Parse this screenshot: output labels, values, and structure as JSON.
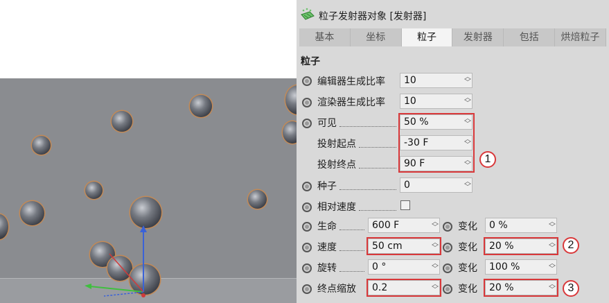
{
  "window": {
    "title": "粒子发射器对象 [发射器]"
  },
  "tabs": [
    {
      "label": "基本",
      "active": false
    },
    {
      "label": "坐标",
      "active": false
    },
    {
      "label": "粒子",
      "active": true
    },
    {
      "label": "发射器",
      "active": false
    },
    {
      "label": "包括",
      "active": false
    },
    {
      "label": "烘焙粒子",
      "active": false
    }
  ],
  "section_title": "粒子",
  "params": {
    "editor_rate": {
      "label": "编辑器生成比率",
      "value": "10"
    },
    "render_rate": {
      "label": "渲染器生成比率",
      "value": "10"
    },
    "visibility": {
      "label": "可见",
      "value": "50 %"
    },
    "start_emission": {
      "label": "投射起点",
      "value": "-30 F"
    },
    "stop_emission": {
      "label": "投射终点",
      "value": "90 F"
    },
    "seed": {
      "label": "种子",
      "value": "0"
    },
    "relative_speed": {
      "label": "相对速度",
      "checked": false
    },
    "lifetime": {
      "label": "生命",
      "value": "600 F",
      "variation_label": "变化",
      "variation": "0 %"
    },
    "speed": {
      "label": "速度",
      "value": "50 cm",
      "variation_label": "变化",
      "variation": "20 %"
    },
    "rotation": {
      "label": "旋转",
      "value": "0 °",
      "variation_label": "变化",
      "variation": "100 %"
    },
    "end_scale": {
      "label": "终点缩放",
      "value": "0.2",
      "variation_label": "变化",
      "variation": "20 %"
    }
  },
  "callouts": [
    "1",
    "2",
    "3"
  ],
  "colors": {
    "highlight": "#d9383a",
    "panel_bg": "#d9d9d9",
    "viewport_bg": "#8a8c90",
    "particle_outline": "#c48a55"
  },
  "icons": {
    "title": "emitter-icon",
    "spinner": "spinner-arrows-icon"
  }
}
